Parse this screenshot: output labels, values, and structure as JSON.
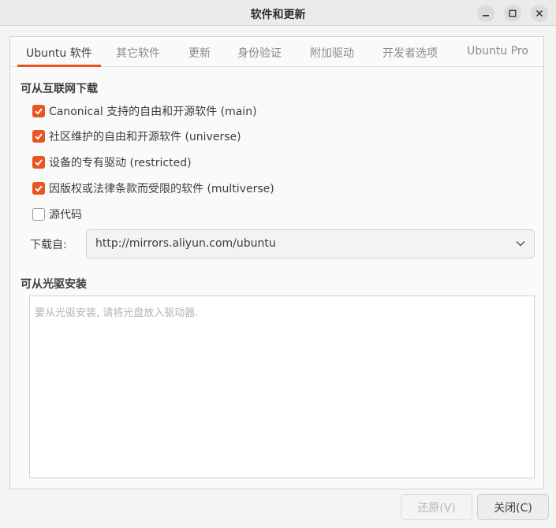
{
  "window": {
    "title": "软件和更新"
  },
  "tabs": [
    {
      "label": "Ubuntu 软件",
      "active": true
    },
    {
      "label": "其它软件"
    },
    {
      "label": "更新"
    },
    {
      "label": "身份验证"
    },
    {
      "label": "附加驱动"
    },
    {
      "label": "开发者选项"
    },
    {
      "label": "Ubuntu Pro"
    }
  ],
  "internet": {
    "title": "可从互联网下载",
    "options": [
      {
        "label": "Canonical 支持的自由和开源软件 (main)",
        "checked": true
      },
      {
        "label": "社区维护的自由和开源软件 (universe)",
        "checked": true
      },
      {
        "label": "设备的专有驱动 (restricted)",
        "checked": true
      },
      {
        "label": "因版权或法律条款而受限的软件 (multiverse)",
        "checked": true
      },
      {
        "label": "源代码",
        "checked": false
      }
    ],
    "download_from_label": "下载自:",
    "download_from_value": "http://mirrors.aliyun.com/ubuntu"
  },
  "cdrom": {
    "title": "可从光驱安装",
    "placeholder": "要从光驱安装, 请将光盘放入驱动器."
  },
  "footer": {
    "revert_label": "还原(V)",
    "close_label": "关闭(C)"
  },
  "colors": {
    "accent": "#e95420"
  }
}
